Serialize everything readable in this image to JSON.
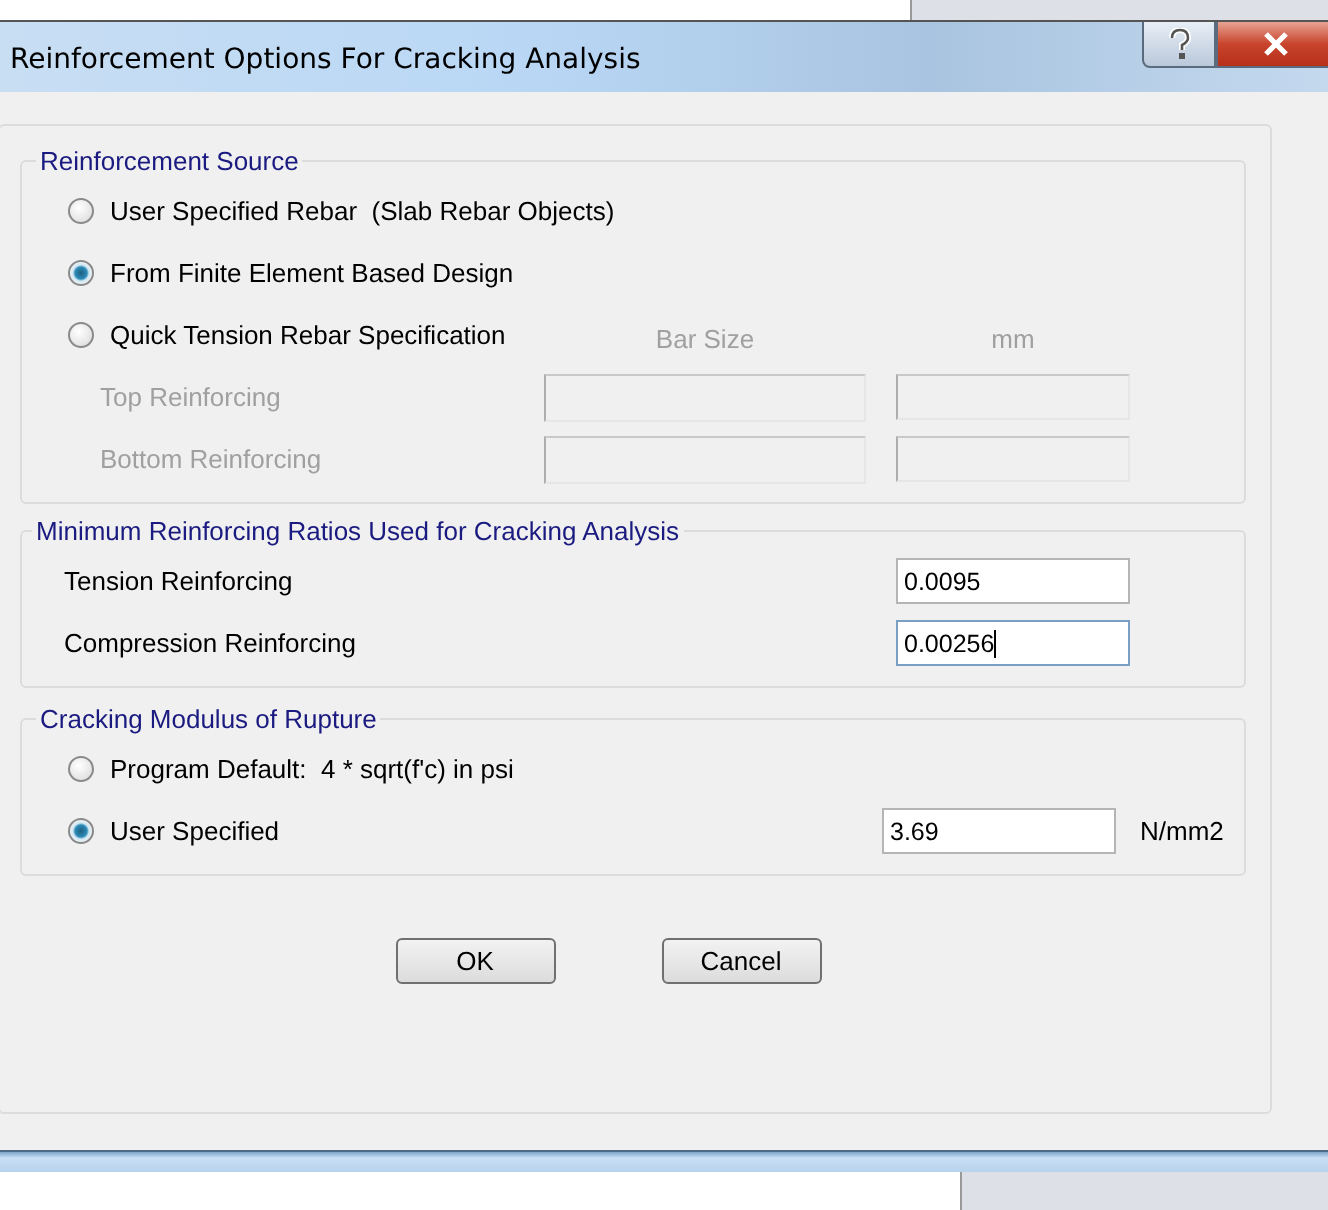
{
  "window": {
    "title": "Reinforcement Options For Cracking Analysis"
  },
  "reinforcement_source": {
    "title": "Reinforcement Source",
    "options": [
      {
        "label": "User Specified Rebar  (Slab Rebar Objects)",
        "selected": false
      },
      {
        "label": "From Finite Element Based Design",
        "selected": true
      },
      {
        "label": "Quick Tension Rebar Specification",
        "selected": false
      }
    ],
    "quick_spec": {
      "disabled": true,
      "column_headers": [
        "Bar Size",
        "mm"
      ],
      "rows": [
        {
          "label": "Top Reinforcing"
        },
        {
          "label": "Bottom Reinforcing"
        }
      ]
    }
  },
  "minimum_ratios": {
    "title": "Minimum Reinforcing Ratios Used for Cracking Analysis",
    "rows": [
      {
        "label": "Tension Reinforcing",
        "value": "0.0095",
        "focused": false
      },
      {
        "label": "Compression Reinforcing",
        "value": "0.00256",
        "focused": true
      }
    ]
  },
  "modulus_of_rupture": {
    "title": "Cracking Modulus of Rupture",
    "options": [
      {
        "label": "Program Default:  4 * sqrt(f'c) in psi",
        "selected": false
      },
      {
        "label": "User Specified",
        "selected": true
      }
    ],
    "value": "3.69",
    "unit": "N/mm2"
  },
  "buttons": [
    "OK",
    "Cancel"
  ]
}
